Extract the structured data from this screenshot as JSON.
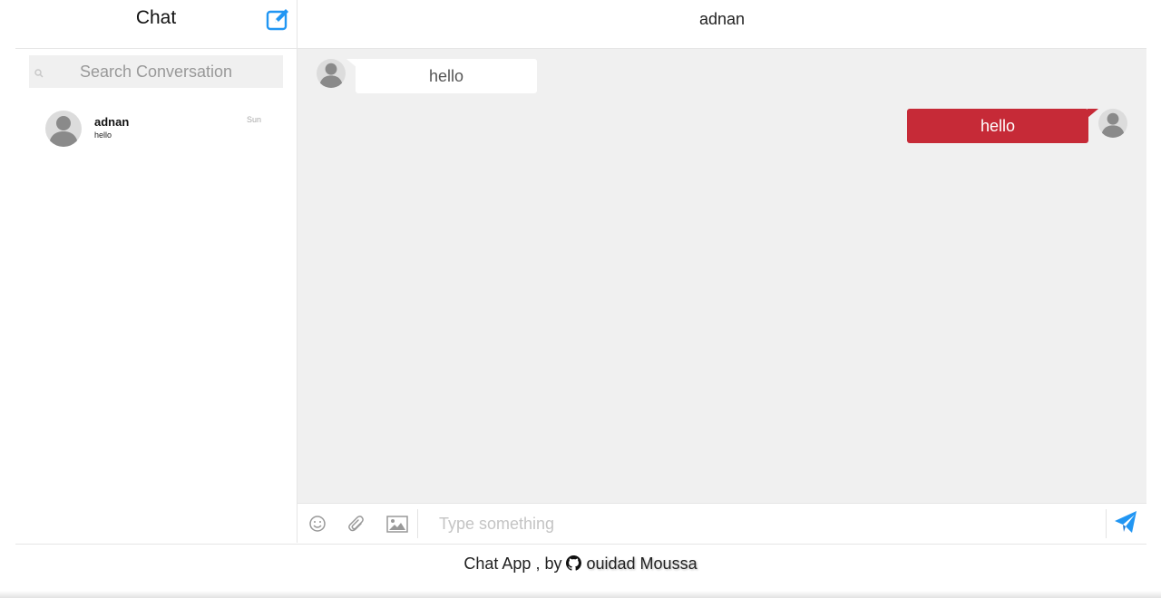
{
  "sidebar": {
    "title": "Chat",
    "search_placeholder": "Search Conversation",
    "conversations": [
      {
        "name": "adnan",
        "preview": "hello",
        "date": "Sun"
      }
    ]
  },
  "chat": {
    "title": "adnan",
    "messages": [
      {
        "direction": "incoming",
        "text": "hello"
      },
      {
        "direction": "outgoing",
        "text": "hello"
      }
    ],
    "input_placeholder": "Type something"
  },
  "footer": {
    "prefix": "Chat App , by",
    "author": "ouidad Moussa"
  },
  "colors": {
    "accent": "#2196f3",
    "outgoing_bubble": "#c62a37",
    "messages_background": "#f0f0f0"
  },
  "icons": [
    "compose-icon",
    "search-icon",
    "emoji-icon",
    "attach-icon",
    "image-icon",
    "send-icon",
    "github-icon"
  ]
}
